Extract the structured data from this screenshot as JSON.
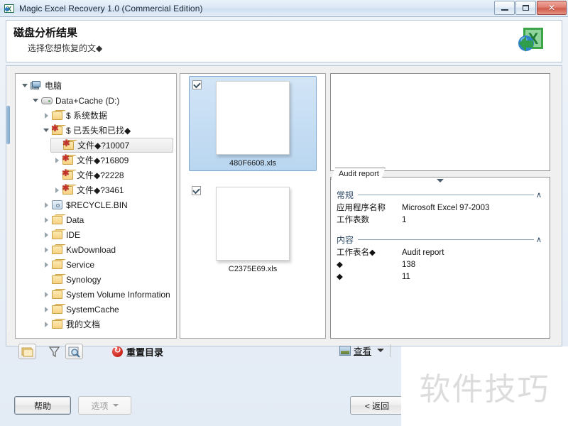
{
  "window": {
    "title": "Magic Excel Recovery 1.0 (Commercial Edition)",
    "app_icon": "excel-recovery-icon",
    "minimize_label": "–",
    "maximize_label": "□",
    "close_label": "✕"
  },
  "header": {
    "title": "磁盘分析结果",
    "subtitle": "选择您想恢复的文◆",
    "logo": "excel-recovery-logo"
  },
  "tree": {
    "items": [
      {
        "label": "电脑",
        "icon": "computer-icon",
        "depth": 0,
        "twisty": "expanded",
        "selected": false
      },
      {
        "label": "Data+Cache (D:)",
        "icon": "drive-icon",
        "depth": 1,
        "twisty": "expanded",
        "selected": false
      },
      {
        "label": "$ 系统数据",
        "icon": "folder-icon",
        "depth": 2,
        "twisty": "collapsed",
        "selected": false
      },
      {
        "label": "$ 已丢失和已找◆",
        "icon": "folder-lost-icon",
        "depth": 2,
        "twisty": "expanded",
        "selected": false
      },
      {
        "label": "文件◆?10007",
        "icon": "folder-lost-icon",
        "depth": 3,
        "twisty": "none",
        "selected": true
      },
      {
        "label": "文件◆?16809",
        "icon": "folder-lost-icon",
        "depth": 3,
        "twisty": "collapsed",
        "selected": false
      },
      {
        "label": "文件◆?2228",
        "icon": "folder-lost-icon",
        "depth": 3,
        "twisty": "none",
        "selected": false
      },
      {
        "label": "文件◆?3461",
        "icon": "folder-lost-icon",
        "depth": 3,
        "twisty": "collapsed",
        "selected": false
      },
      {
        "label": "$RECYCLE.BIN",
        "icon": "recycle-bin-icon",
        "depth": 2,
        "twisty": "collapsed",
        "selected": false
      },
      {
        "label": "Data",
        "icon": "folder-icon",
        "depth": 2,
        "twisty": "collapsed",
        "selected": false
      },
      {
        "label": "IDE",
        "icon": "folder-icon",
        "depth": 2,
        "twisty": "collapsed",
        "selected": false
      },
      {
        "label": "KwDownload",
        "icon": "folder-icon",
        "depth": 2,
        "twisty": "collapsed",
        "selected": false
      },
      {
        "label": "Service",
        "icon": "folder-icon",
        "depth": 2,
        "twisty": "collapsed",
        "selected": false
      },
      {
        "label": "Synology",
        "icon": "folder-icon",
        "depth": 2,
        "twisty": "none",
        "selected": false
      },
      {
        "label": "System Volume Information",
        "icon": "folder-icon",
        "depth": 2,
        "twisty": "collapsed",
        "selected": false
      },
      {
        "label": "SystemCache",
        "icon": "folder-icon",
        "depth": 2,
        "twisty": "collapsed",
        "selected": false
      },
      {
        "label": "我的文档",
        "icon": "folder-icon",
        "depth": 2,
        "twisty": "collapsed",
        "selected": false
      }
    ]
  },
  "thumbnails": {
    "items": [
      {
        "name": "480F6608.xls",
        "checked": true,
        "selected": true
      },
      {
        "name": "C2375E69.xls",
        "checked": true,
        "selected": false
      }
    ]
  },
  "properties": {
    "tab_label": "Audit report",
    "sections": [
      {
        "title": "常规",
        "collapse_glyph": "∧",
        "rows": [
          {
            "key": "应用程序名称",
            "value": "Microsoft Excel 97-2003"
          },
          {
            "key": "工作表数",
            "value": "1"
          }
        ]
      },
      {
        "title": "内容",
        "collapse_glyph": "∧",
        "rows": [
          {
            "key": "工作表名◆",
            "value": "Audit report"
          },
          {
            "key": "◆",
            "value": "138"
          },
          {
            "key": "◆",
            "value": "11"
          }
        ]
      }
    ]
  },
  "actionbar": {
    "buttons": [
      {
        "name": "folders-icon",
        "glyph": "🗂"
      },
      {
        "name": "filter-icon",
        "glyph": "▽"
      },
      {
        "name": "find-icon",
        "glyph": "🔍"
      }
    ],
    "reset_label": "重置目录",
    "reset_icon": "refresh-icon",
    "view_label": "查看",
    "view_icon": "view-image-icon"
  },
  "footer": {
    "help_label": "帮助",
    "options_label": "选项",
    "back_label": "< 返回"
  },
  "watermark": {
    "text": "软件技巧"
  }
}
